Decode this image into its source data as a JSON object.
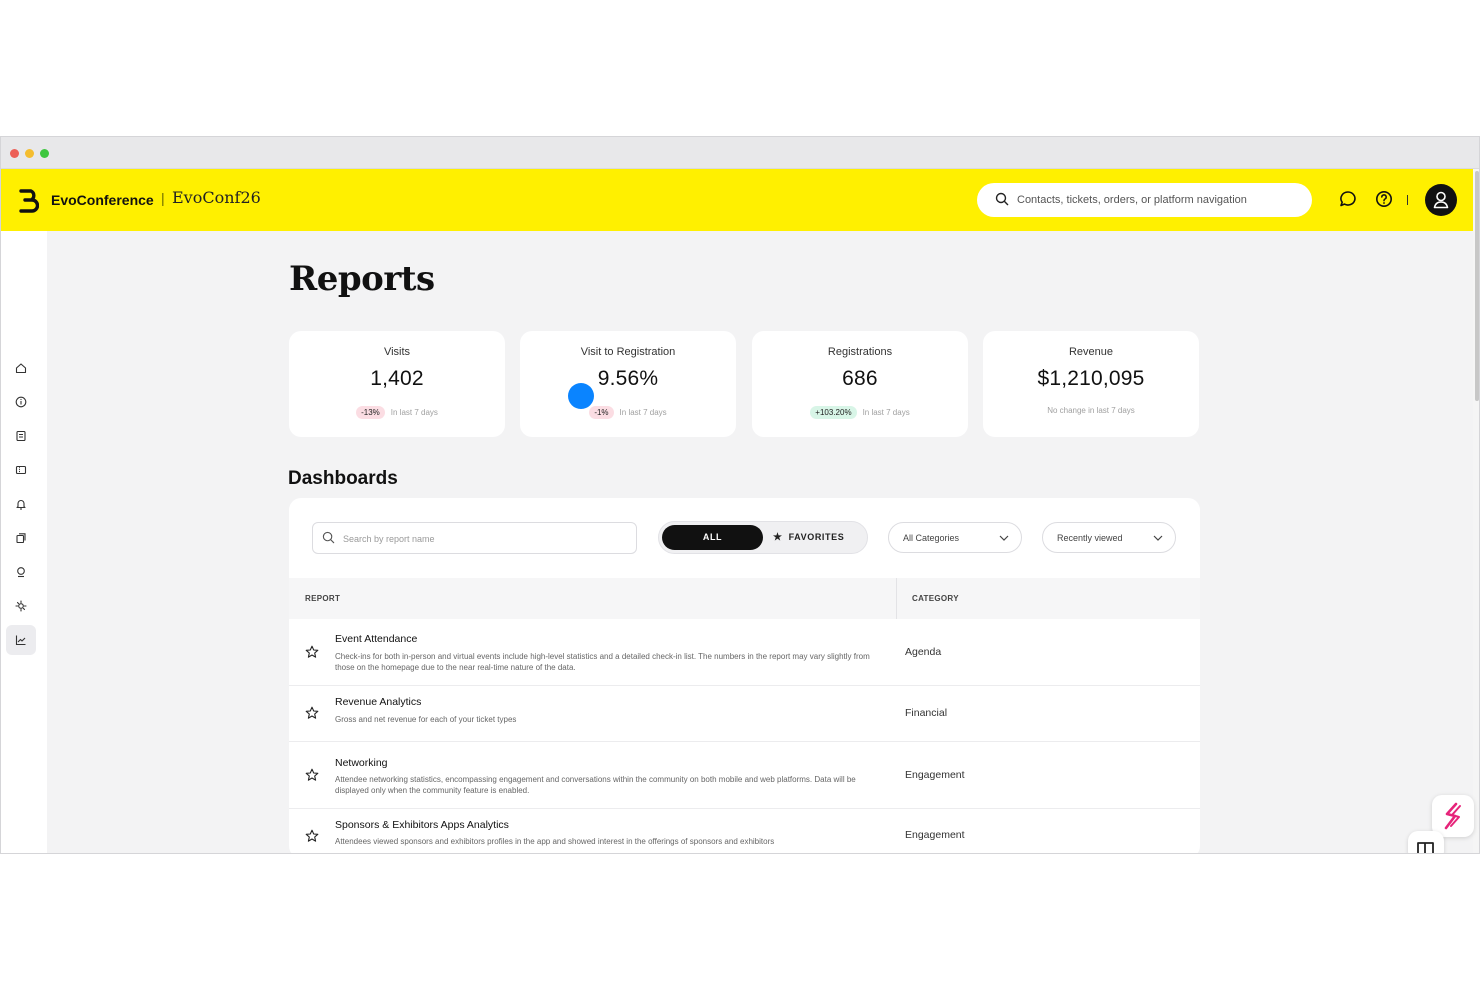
{
  "topbar": {
    "brand": "EvoConference",
    "separator": "|",
    "event_name": "EvoConf26",
    "search_placeholder": "Contacts, tickets, orders, or platform navigation"
  },
  "page": {
    "title": "Reports"
  },
  "stats": [
    {
      "label": "Visits",
      "value": "1,402",
      "change": "-13%",
      "change_type": "negative",
      "note": "In last 7 days"
    },
    {
      "label": "Visit to Registration",
      "value": "9.56%",
      "change": "-1%",
      "change_type": "negative",
      "note": "In last 7 days"
    },
    {
      "label": "Registrations",
      "value": "686",
      "change": "+103.20%",
      "change_type": "positive",
      "note": "In last 7 days"
    },
    {
      "label": "Revenue",
      "value": "$1,210,095",
      "change": "",
      "change_type": "none",
      "note": "No change in last 7 days"
    }
  ],
  "dashboards": {
    "title": "Dashboards",
    "search_placeholder": "Search by report name",
    "toggle_all": "ALL",
    "toggle_favorites": "FAVORITES",
    "category_select": "All Categories",
    "sort_select": "Recently viewed",
    "columns": {
      "report": "REPORT",
      "category": "CATEGORY"
    },
    "rows": [
      {
        "name": "Event Attendance",
        "description": "Check-ins for both in-person and virtual events include high-level statistics and a detailed check-in list. The numbers in the report may vary slightly from those on the homepage due to the near real-time nature of the data.",
        "category": "Agenda"
      },
      {
        "name": "Revenue Analytics",
        "description": "Gross and net revenue for each of your ticket types",
        "category": "Financial"
      },
      {
        "name": "Networking",
        "description": "Attendee networking statistics, encompassing engagement and conversations within the community on both mobile and web platforms. Data will be displayed only when the community feature is enabled.",
        "category": "Engagement"
      },
      {
        "name": "Sponsors & Exhibitors Apps Analytics",
        "description": "Attendees viewed sponsors and exhibitors profiles in the app and showed interest in the offerings of sponsors and exhibitors",
        "category": "Engagement"
      }
    ]
  },
  "sidebar": {
    "items": [
      "home-icon",
      "info-icon",
      "agenda-icon",
      "ticket-icon",
      "notifications-icon",
      "pages-icon",
      "location-icon",
      "settings-icon",
      "reports-icon"
    ],
    "active": "reports-icon"
  },
  "colors": {
    "brand_yellow": "#fff000",
    "negative_badge": "#fbdde3",
    "positive_badge": "#d8f5e7",
    "cursor_blue": "#0a84ff"
  }
}
